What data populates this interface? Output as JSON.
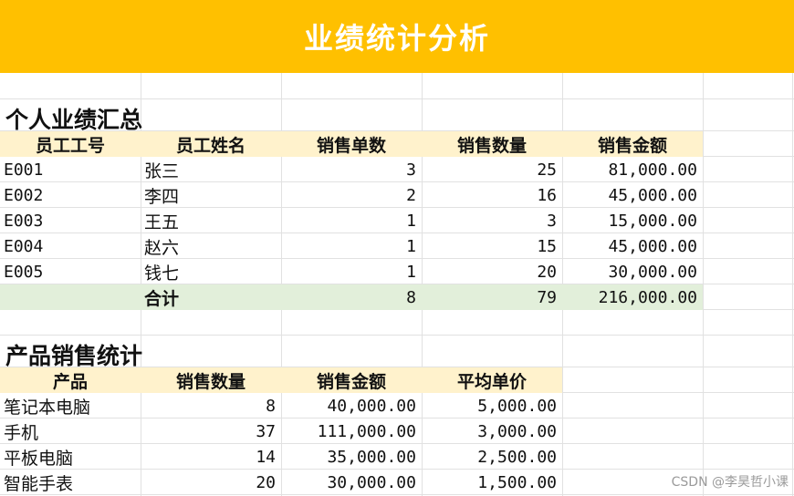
{
  "title": "业绩统计分析",
  "section1": {
    "title": "个人业绩汇总",
    "headers": [
      "员工工号",
      "员工姓名",
      "销售单数",
      "销售数量",
      "销售金额"
    ],
    "rows": [
      {
        "id": "E001",
        "name": "张三",
        "orders": "3",
        "qty": "25",
        "amount": "81,000.00"
      },
      {
        "id": "E002",
        "name": "李四",
        "orders": "2",
        "qty": "16",
        "amount": "45,000.00"
      },
      {
        "id": "E003",
        "name": "王五",
        "orders": "1",
        "qty": "3",
        "amount": "15,000.00"
      },
      {
        "id": "E004",
        "name": "赵六",
        "orders": "1",
        "qty": "15",
        "amount": "45,000.00"
      },
      {
        "id": "E005",
        "name": "钱七",
        "orders": "1",
        "qty": "20",
        "amount": "30,000.00"
      }
    ],
    "total": {
      "label": "合计",
      "orders": "8",
      "qty": "79",
      "amount": "216,000.00"
    }
  },
  "section2": {
    "title": "产品销售统计",
    "headers": [
      "产品",
      "销售数量",
      "销售金额",
      "平均单价"
    ],
    "rows": [
      {
        "product": "笔记本电脑",
        "qty": "8",
        "amount": "40,000.00",
        "avg": "5,000.00"
      },
      {
        "product": "手机",
        "qty": "37",
        "amount": "111,000.00",
        "avg": "3,000.00"
      },
      {
        "product": "平板电脑",
        "qty": "14",
        "amount": "35,000.00",
        "avg": "2,500.00"
      },
      {
        "product": "智能手表",
        "qty": "20",
        "amount": "30,000.00",
        "avg": "1,500.00"
      }
    ]
  },
  "watermark": "CSDN @李昊哲小课",
  "colors": {
    "title_bg": "#ffc000",
    "header_bg": "#fff2cc",
    "total_bg": "#e2efda"
  }
}
